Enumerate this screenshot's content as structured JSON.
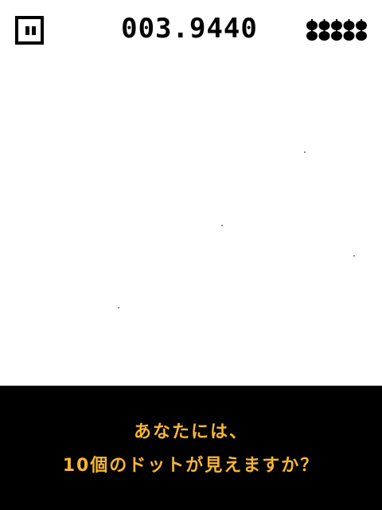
{
  "hud": {
    "pause_icon": "pause-icon",
    "timer": "003.9440",
    "lives_icon": "blob-life-icon",
    "lives_count": 10
  },
  "play_area": {
    "dot_color": "#8a8a8a",
    "background": "#ffffff"
  },
  "message": {
    "line1": "あなたには、",
    "line2": "10個のドットが見えますか？",
    "text_color": "#f5b632",
    "panel_color": "#000000"
  }
}
